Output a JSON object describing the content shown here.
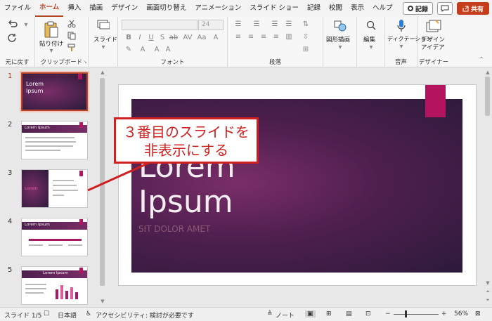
{
  "menu": {
    "tabs": [
      "ファイル",
      "ホーム",
      "挿入",
      "描画",
      "デザイン",
      "画面切り替え",
      "アニメーション",
      "スライド ショー",
      "記録",
      "校閲",
      "表示",
      "ヘルプ"
    ],
    "active_tab": "ホーム",
    "record_label": "記録",
    "share_label": "共有"
  },
  "ribbon": {
    "undo_group": "元に戻す",
    "clipboard": {
      "paste_label": "貼り付け",
      "group_label": "クリップボード"
    },
    "slides": {
      "slide_label": "スライド"
    },
    "font": {
      "size_value": "24",
      "group_label": "フォント"
    },
    "paragraph": {
      "group_label": "段落"
    },
    "shapes_label": "図形描画",
    "edit_label": "編集",
    "dictate_label": "ディクテーション",
    "voice_group": "音声",
    "designer_label_1": "デザイン",
    "designer_label_2": "アイデア",
    "designer_group": "デザイナー"
  },
  "thumbnails": [
    {
      "num": "1",
      "title": "Lorem Ipsum",
      "selected": true
    },
    {
      "num": "2",
      "title": "Lorem Ipsum",
      "selected": false
    },
    {
      "num": "3",
      "title": "Lorem",
      "selected": false
    },
    {
      "num": "4",
      "title": "Lorem Ipsum",
      "selected": false
    },
    {
      "num": "5",
      "title": "Lorem Ipsum",
      "selected": false
    }
  ],
  "slide": {
    "title_line1": "Lorem",
    "title_line2": "Ipsum",
    "subtitle": "SIT DOLOR AMET"
  },
  "callout": {
    "line1": "３番目のスライドを",
    "line2": "非表示にする"
  },
  "status": {
    "slide_count": "スライド 1/5",
    "language": "日本語",
    "accessibility": "アクセシビリティ: 検討が必要です",
    "notes": "ノート",
    "zoom": "56%"
  },
  "colors": {
    "accent": "#b7472a",
    "share": "#c43e1c",
    "slide_tab": "#b4135e",
    "callout": "#d01f1f"
  }
}
